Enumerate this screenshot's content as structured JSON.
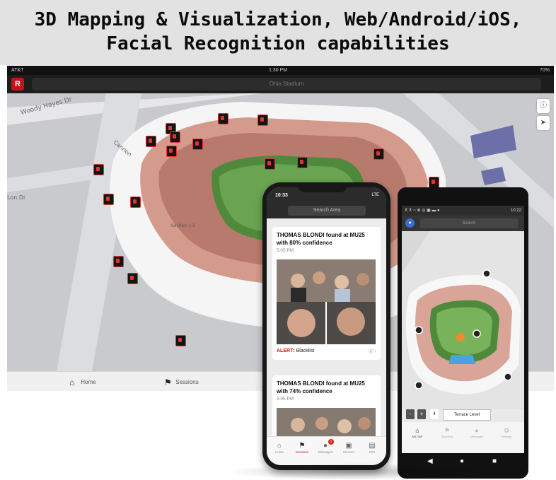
{
  "banner": {
    "line1": "3D Mapping & Visualization, Web/Android/iOS,",
    "line2": "Facial Recognition capabilities"
  },
  "ipad": {
    "status": {
      "carrier": "AT&T",
      "time": "1:30 PM",
      "battery": "70%"
    },
    "nav": {
      "logo": "R",
      "search_text": "Ohio Stadium"
    },
    "map_labels": {
      "street1": "Woody Hayes Dr",
      "street2": "Cannon",
      "street3": "Lon Dr",
      "section": "Section 1-5"
    },
    "map_buttons": {
      "info": "ⓘ",
      "locate": "➤"
    },
    "tabs": [
      {
        "label": "Home",
        "icon": "home-icon",
        "glyph": "⌂"
      },
      {
        "label": "Sessions",
        "icon": "flag-icon",
        "glyph": "⚑"
      }
    ]
  },
  "iphone": {
    "status": {
      "time": "10:33",
      "signal": "LTE"
    },
    "search_placeholder": "Search Area",
    "cards": [
      {
        "title": "THOMAS BLONDI found at MU25 with 80% confidence",
        "time": "5:05 PM",
        "alert_prefix": "ALERT!",
        "alert_text": "Blacklist",
        "more": "⓪ ›"
      },
      {
        "title": "THOMAS BLONDI found at MU25 with 74% confidence",
        "time": "5:05 PM"
      }
    ],
    "tabs": [
      {
        "label": "Home",
        "glyph": "⌂"
      },
      {
        "label": "Sessions",
        "glyph": "⚑"
      },
      {
        "label": "Messages",
        "glyph": "●",
        "badge": "1"
      },
      {
        "label": "Sensors",
        "glyph": "▣"
      },
      {
        "label": "POI",
        "glyph": "▤"
      }
    ]
  },
  "android": {
    "status": {
      "icons": "⊼ ⊼ ○ ⊗ ◎ ▣ ▬ ●",
      "time": "10:22"
    },
    "search_placeholder": "Search",
    "floor": {
      "minus": "-",
      "plus": "+",
      "number": "4",
      "level": "Terrace Level"
    },
    "tabs": [
      {
        "label": "MY TAP",
        "glyph": "⌂"
      },
      {
        "label": "Sessions",
        "glyph": "⚑"
      },
      {
        "label": "Messages",
        "glyph": "●"
      },
      {
        "label": "Settings",
        "glyph": "⚙"
      }
    ],
    "nav": {
      "back": "◀",
      "home": "●",
      "recents": "■"
    }
  }
}
